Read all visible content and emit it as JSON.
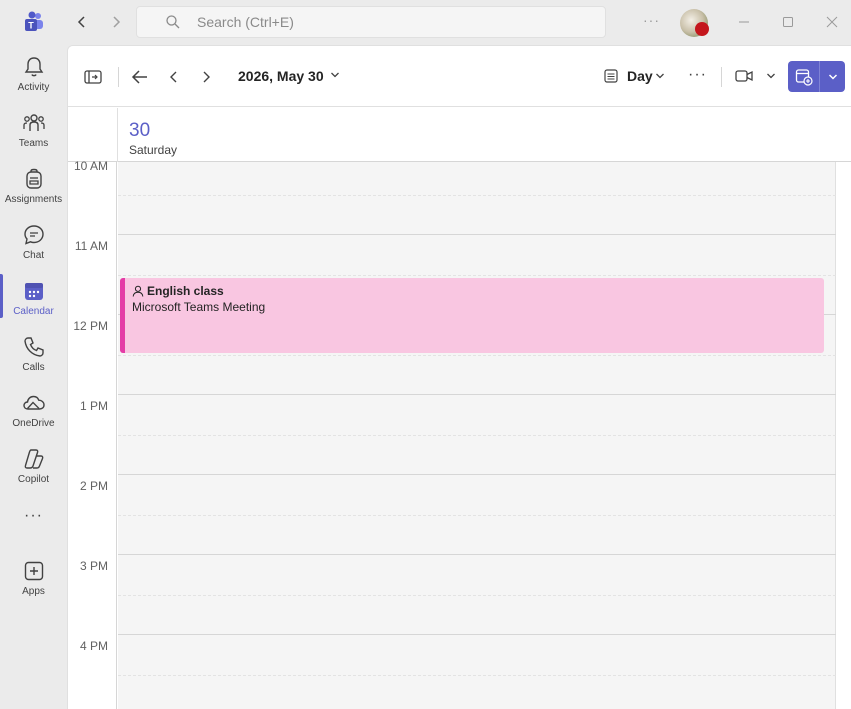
{
  "titlebar": {
    "search_placeholder": "Search (Ctrl+E)",
    "more_label": "···"
  },
  "rail": {
    "items": [
      {
        "label": "Activity",
        "icon": "bell-icon"
      },
      {
        "label": "Teams",
        "icon": "teams-icon"
      },
      {
        "label": "Assignments",
        "icon": "backpack-icon"
      },
      {
        "label": "Chat",
        "icon": "chat-icon"
      },
      {
        "label": "Calendar",
        "icon": "calendar-icon",
        "active": true
      },
      {
        "label": "Calls",
        "icon": "phone-icon"
      },
      {
        "label": "OneDrive",
        "icon": "cloud-icon"
      },
      {
        "label": "Copilot",
        "icon": "copilot-icon"
      },
      {
        "label": "···",
        "icon": "more-icon"
      },
      {
        "label": "Apps",
        "icon": "add-app-icon"
      }
    ]
  },
  "toolbar": {
    "date_label": "2026, May 30",
    "view_label": "Day",
    "more_label": "···"
  },
  "day": {
    "number": "30",
    "name": "Saturday"
  },
  "time_labels": [
    "10 AM",
    "11 AM",
    "12 PM",
    "1 PM",
    "2 PM",
    "3 PM",
    "4 PM"
  ],
  "event": {
    "title": "English class",
    "subtitle": "Microsoft Teams Meeting"
  },
  "colors": {
    "accent": "#5b5fc7",
    "event_fill": "#f9c6e1",
    "event_bar": "#e43ba6"
  }
}
